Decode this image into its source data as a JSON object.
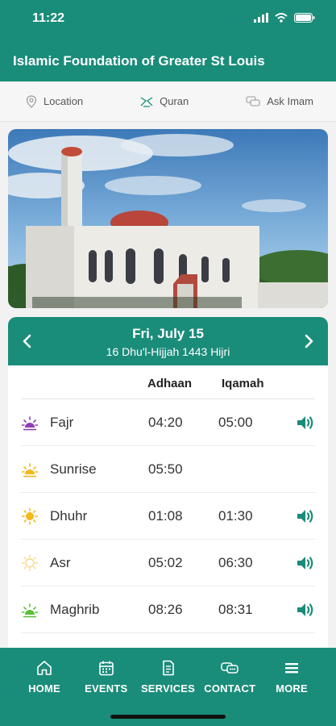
{
  "status": {
    "time": "11:22"
  },
  "header": {
    "title": "Islamic Foundation of Greater St Louis"
  },
  "quicklinks": [
    {
      "label": "Location",
      "icon": "location-pin-icon"
    },
    {
      "label": "Quran",
      "icon": "quran-book-icon"
    },
    {
      "label": "Ask Imam",
      "icon": "chat-bubbles-icon"
    }
  ],
  "date": {
    "gregorian": "Fri, July 15",
    "hijri": "16 Dhu'l-Hijjah 1443 Hijri"
  },
  "table": {
    "col_adhaan": "Adhaan",
    "col_iqamah": "Iqamah",
    "rows": [
      {
        "name": "Fajr",
        "adhaan": "04:20",
        "iqamah": "05:00",
        "icon_color": "#8e3fb5"
      },
      {
        "name": "Sunrise",
        "adhaan": "05:50",
        "iqamah": "",
        "icon_color": "#f2b81c"
      },
      {
        "name": "Dhuhr",
        "adhaan": "01:08",
        "iqamah": "01:30",
        "icon_color": "#f2b81c"
      },
      {
        "name": "Asr",
        "adhaan": "05:02",
        "iqamah": "06:30",
        "icon_color": "#f5d98a"
      },
      {
        "name": "Maghrib",
        "adhaan": "08:26",
        "iqamah": "08:31",
        "icon_color": "#5bbf3a"
      }
    ]
  },
  "tabs": [
    {
      "label": "HOME",
      "icon": "home-icon"
    },
    {
      "label": "EVENTS",
      "icon": "calendar-icon"
    },
    {
      "label": "SERVICES",
      "icon": "document-icon"
    },
    {
      "label": "CONTACT",
      "icon": "contact-icon"
    },
    {
      "label": "MORE",
      "icon": "menu-icon"
    }
  ],
  "colors": {
    "primary": "#1a8c7a"
  }
}
